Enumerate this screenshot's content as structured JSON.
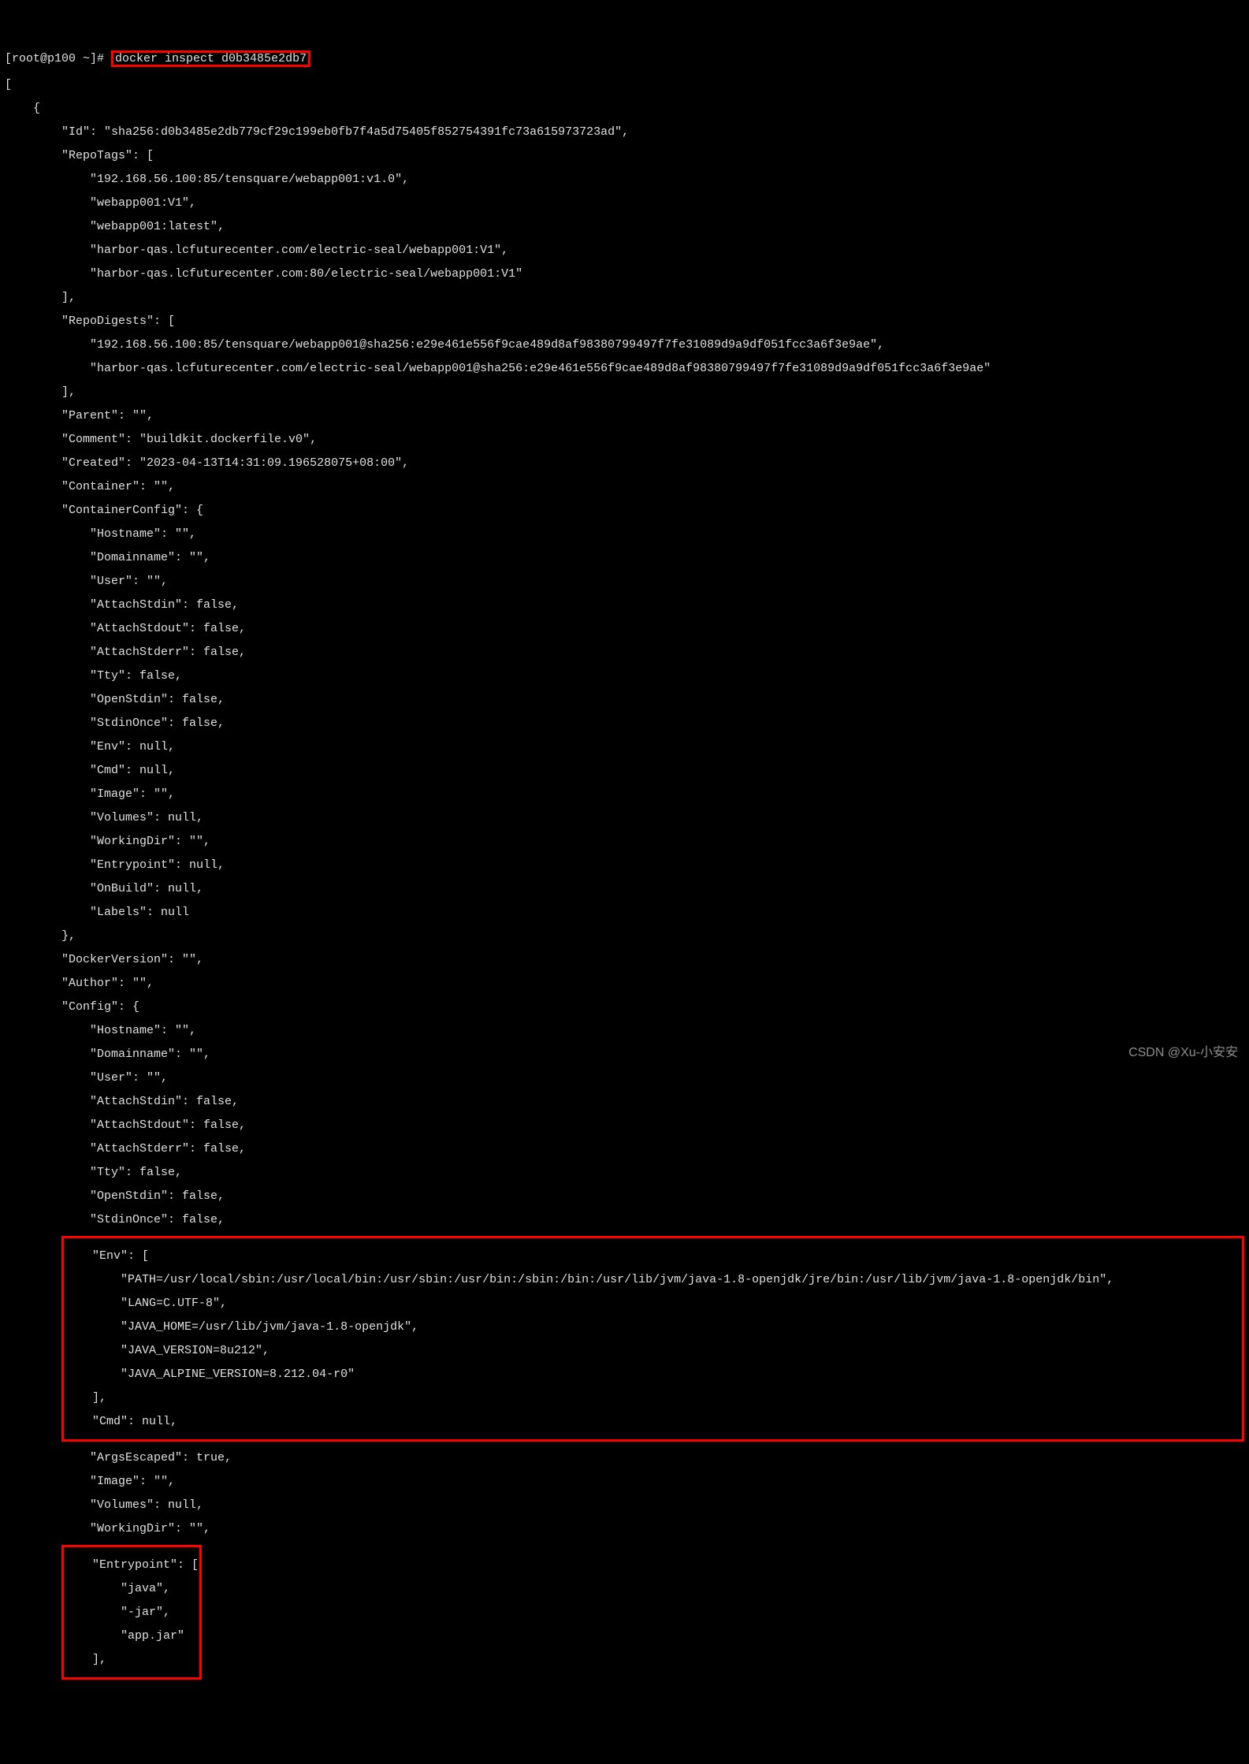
{
  "prompt": "[root@p100 ~]# ",
  "command": "docker inspect d0b3485e2db7",
  "watermark": "CSDN @Xu-小安安",
  "lines": {
    "open_bracket": "[",
    "open_brace": "    {",
    "id": "        \"Id\": \"sha256:d0b3485e2db779cf29c199eb0fb7f4a5d75405f852754391fc73a615973723ad\",",
    "repotags_open": "        \"RepoTags\": [",
    "rt1": "            \"192.168.56.100:85/tensquare/webapp001:v1.0\",",
    "rt2": "            \"webapp001:V1\",",
    "rt3": "            \"webapp001:latest\",",
    "rt4": "            \"harbor-qas.lcfuturecenter.com/electric-seal/webapp001:V1\",",
    "rt5": "            \"harbor-qas.lcfuturecenter.com:80/electric-seal/webapp001:V1\"",
    "repotags_close": "        ],",
    "repodigests_open": "        \"RepoDigests\": [",
    "rd1": "            \"192.168.56.100:85/tensquare/webapp001@sha256:e29e461e556f9cae489d8af98380799497f7fe31089d9a9df051fcc3a6f3e9ae\",",
    "rd2": "            \"harbor-qas.lcfuturecenter.com/electric-seal/webapp001@sha256:e29e461e556f9cae489d8af98380799497f7fe31089d9a9df051fcc3a6f3e9ae\"",
    "repodigests_close": "        ],",
    "parent": "        \"Parent\": \"\",",
    "comment": "        \"Comment\": \"buildkit.dockerfile.v0\",",
    "created": "        \"Created\": \"2023-04-13T14:31:09.196528075+08:00\",",
    "container": "        \"Container\": \"\",",
    "containercfg_open": "        \"ContainerConfig\": {",
    "cc_hostname": "            \"Hostname\": \"\",",
    "cc_domainname": "            \"Domainname\": \"\",",
    "cc_user": "            \"User\": \"\",",
    "cc_attachstdin": "            \"AttachStdin\": false,",
    "cc_attachstdout": "            \"AttachStdout\": false,",
    "cc_attachstderr": "            \"AttachStderr\": false,",
    "cc_tty": "            \"Tty\": false,",
    "cc_openstdin": "            \"OpenStdin\": false,",
    "cc_stdinonce": "            \"StdinOnce\": false,",
    "cc_env": "            \"Env\": null,",
    "cc_cmd": "            \"Cmd\": null,",
    "cc_image": "            \"Image\": \"\",",
    "cc_volumes": "            \"Volumes\": null,",
    "cc_workingdir": "            \"WorkingDir\": \"\",",
    "cc_entrypoint": "            \"Entrypoint\": null,",
    "cc_onbuild": "            \"OnBuild\": null,",
    "cc_labels": "            \"Labels\": null",
    "containercfg_close": "        },",
    "dockerversion": "        \"DockerVersion\": \"\",",
    "author": "        \"Author\": \"\",",
    "config_open": "        \"Config\": {",
    "cf_hostname": "            \"Hostname\": \"\",",
    "cf_domainname": "            \"Domainname\": \"\",",
    "cf_user": "            \"User\": \"\",",
    "cf_attachstdin": "            \"AttachStdin\": false,",
    "cf_attachstdout": "            \"AttachStdout\": false,",
    "cf_attachstderr": "            \"AttachStderr\": false,",
    "cf_tty": "            \"Tty\": false,",
    "cf_openstdin": "            \"OpenStdin\": false,",
    "cf_stdinonce": "            \"StdinOnce\": false,",
    "cf_env_open": "            \"Env\": [",
    "cf_env1": "                \"PATH=/usr/local/sbin:/usr/local/bin:/usr/sbin:/usr/bin:/sbin:/bin:/usr/lib/jvm/java-1.8-openjdk/jre/bin:/usr/lib/jvm/java-1.8-openjdk/bin\",",
    "cf_env2": "                \"LANG=C.UTF-8\",",
    "cf_env3": "                \"JAVA_HOME=/usr/lib/jvm/java-1.8-openjdk\",",
    "cf_env4": "                \"JAVA_VERSION=8u212\",",
    "cf_env5": "                \"JAVA_ALPINE_VERSION=8.212.04-r0\"",
    "cf_env_close": "            ],",
    "cf_cmd": "            \"Cmd\": null,",
    "cf_argsesc": "            \"ArgsEscaped\": true,",
    "cf_image": "            \"Image\": \"\",",
    "cf_volumes": "            \"Volumes\": null,",
    "cf_workingdir": "            \"WorkingDir\": \"\",",
    "cf_ep_open": "            \"Entrypoint\": [",
    "cf_ep1": "                \"java\",",
    "cf_ep2": "                \"-jar\",",
    "cf_ep3": "                \"app.jar\"",
    "cf_ep_close": "            ],"
  }
}
